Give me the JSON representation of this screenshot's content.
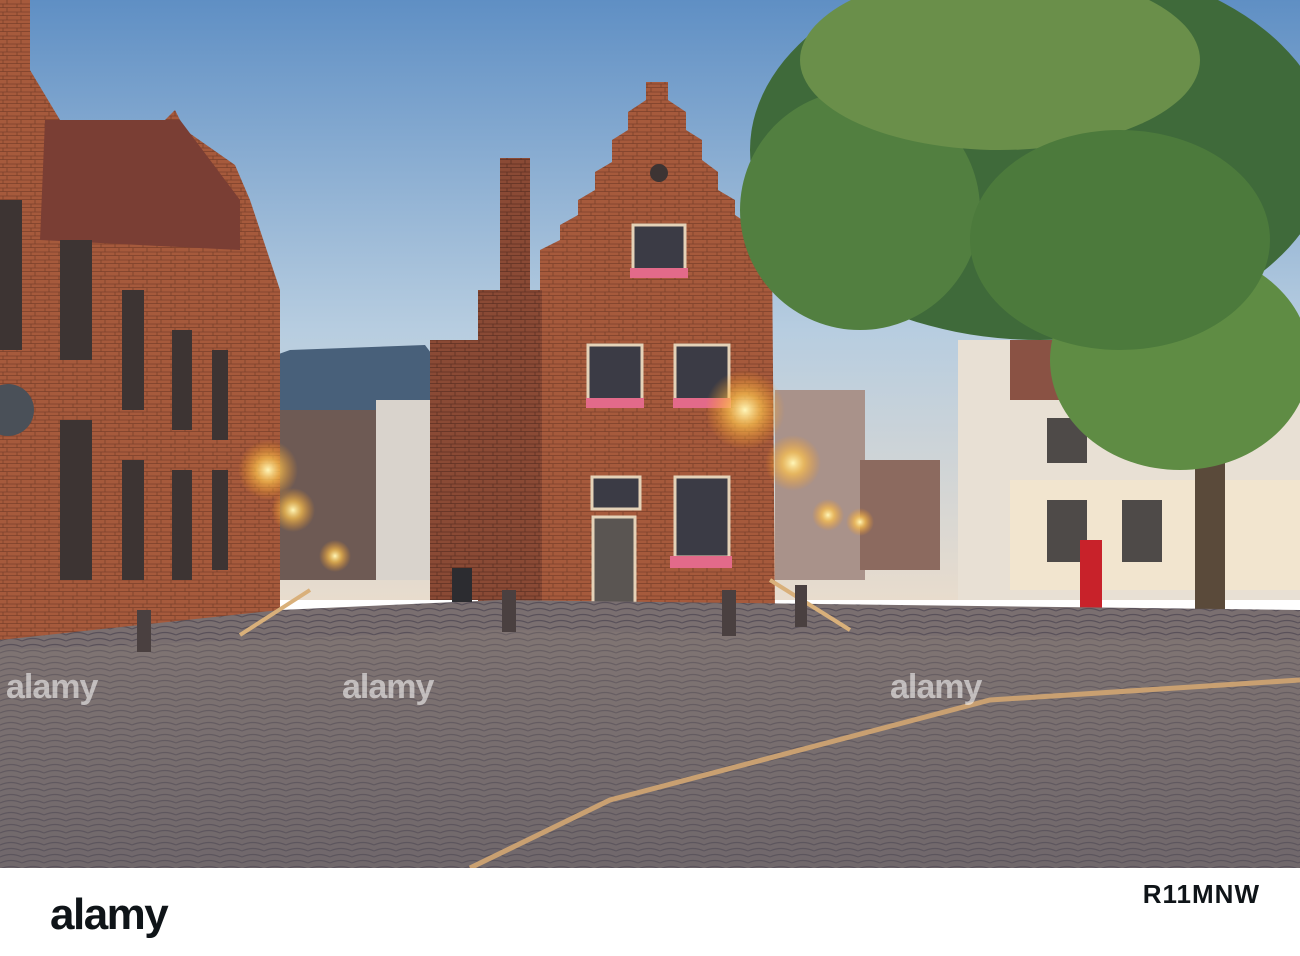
{
  "watermarks": {
    "left": "alamy",
    "center": "alamy",
    "right": "alamy"
  },
  "footer": {
    "brand": "alamy",
    "image_id": "R11MNW"
  }
}
